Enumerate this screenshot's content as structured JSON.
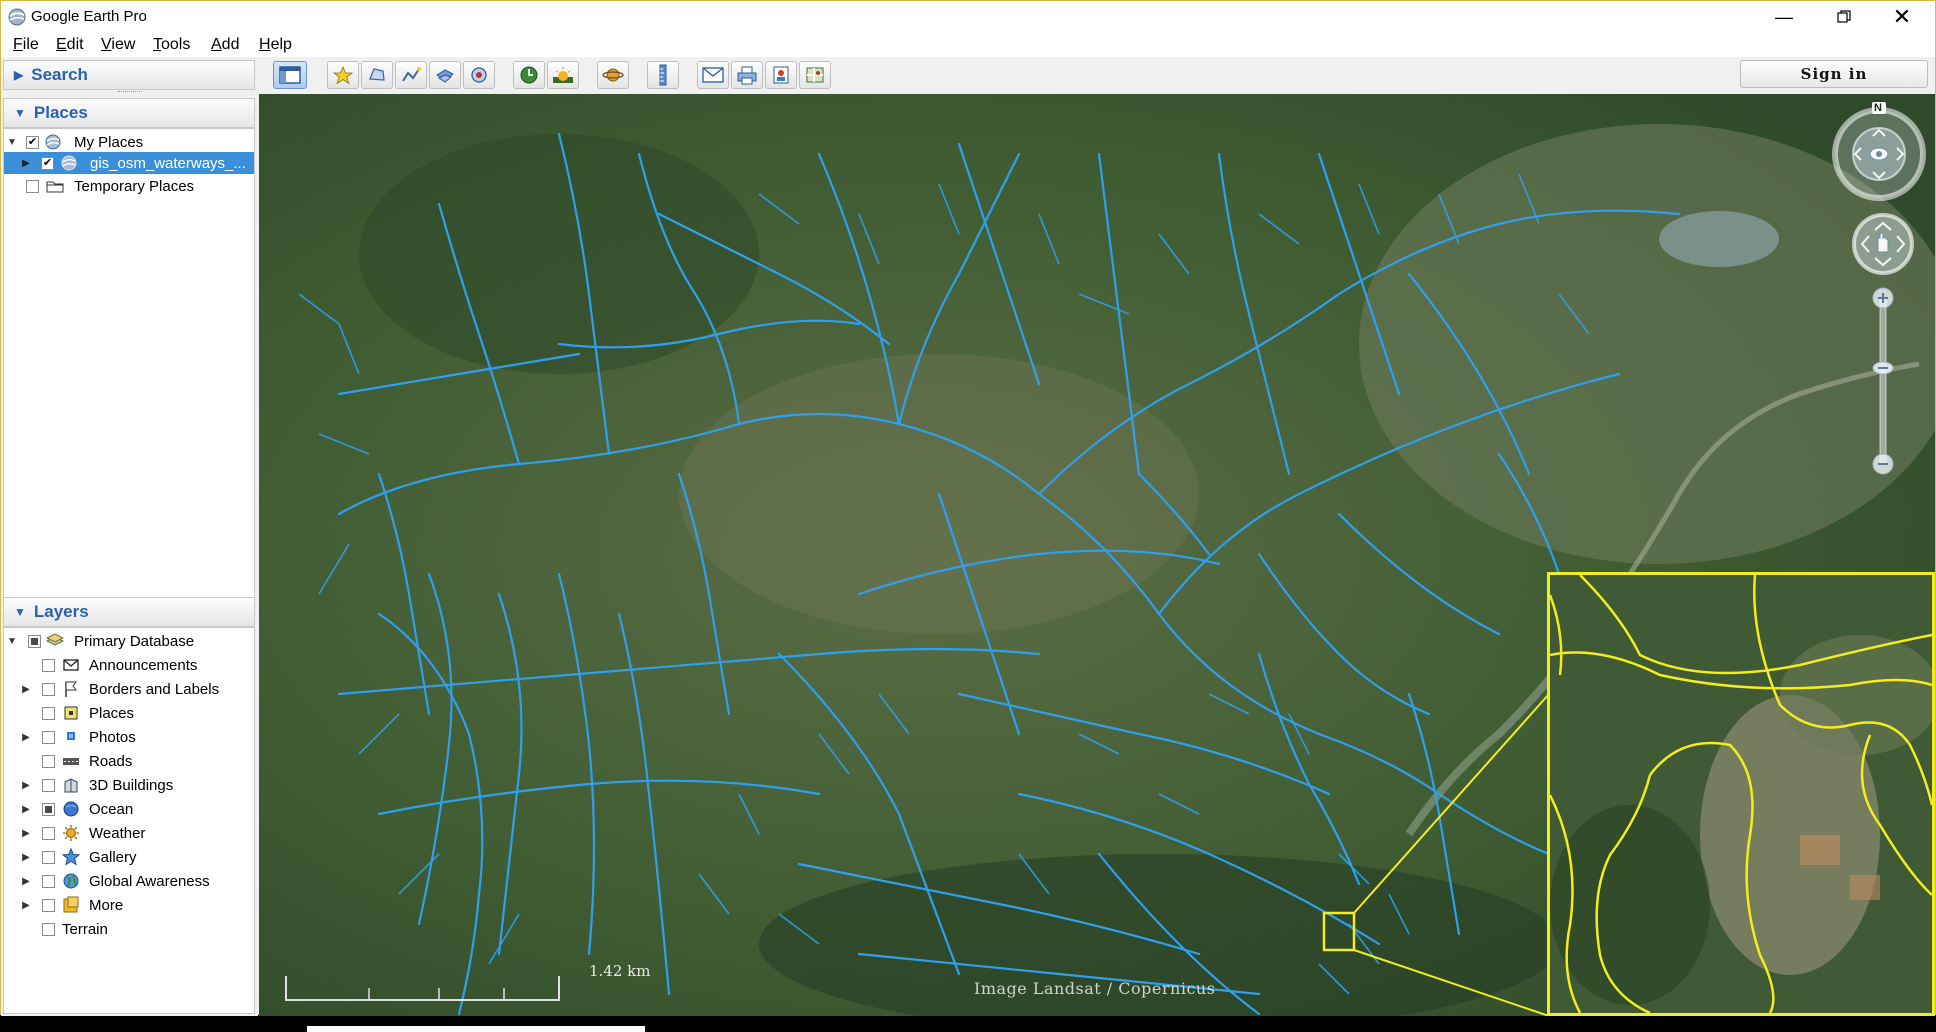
{
  "window": {
    "title": "Google Earth Pro",
    "controls": [
      "minimize",
      "maximize",
      "close"
    ]
  },
  "menu": [
    {
      "label": "File",
      "key": "F",
      "rest": "ile"
    },
    {
      "label": "Edit",
      "key": "E",
      "rest": "dit"
    },
    {
      "label": "View",
      "key": "V",
      "rest": "iew"
    },
    {
      "label": "Tools",
      "key": "T",
      "rest": "ools"
    },
    {
      "label": "Add",
      "key": "A",
      "rest": "dd"
    },
    {
      "label": "Help",
      "key": "H",
      "rest": "elp"
    }
  ],
  "toolbar": {
    "buttons": [
      "sidebar-toggle-icon",
      "placemark-icon",
      "polygon-icon",
      "path-icon",
      "image-overlay-icon",
      "record-tour-icon",
      "historical-imagery-icon",
      "sunlight-icon",
      "planets-icon",
      "ruler-icon",
      "email-icon",
      "print-icon",
      "save-image-icon",
      "view-in-maps-icon"
    ],
    "sign_in": "Sign in"
  },
  "search": {
    "header": "Search"
  },
  "places": {
    "header": "Places",
    "items": [
      {
        "label": "My Places",
        "checked": true
      },
      {
        "label": "gis_osm_waterways_...",
        "checked": true,
        "selected": true
      },
      {
        "label": "Temporary Places",
        "checked": false
      }
    ]
  },
  "layers": {
    "header": "Layers",
    "items": [
      {
        "label": "Primary Database",
        "state": "partial"
      },
      {
        "label": "Announcements",
        "state": "unchecked"
      },
      {
        "label": "Borders and Labels",
        "state": "unchecked"
      },
      {
        "label": "Places",
        "state": "unchecked"
      },
      {
        "label": "Photos",
        "state": "unchecked"
      },
      {
        "label": "Roads",
        "state": "unchecked"
      },
      {
        "label": "3D Buildings",
        "state": "unchecked"
      },
      {
        "label": "Ocean",
        "state": "partial"
      },
      {
        "label": "Weather",
        "state": "unchecked"
      },
      {
        "label": "Gallery",
        "state": "unchecked"
      },
      {
        "label": "Global Awareness",
        "state": "unchecked"
      },
      {
        "label": "More",
        "state": "unchecked"
      },
      {
        "label": "Terrain",
        "state": "unchecked"
      }
    ]
  },
  "map": {
    "credit": "Image Landsat / Copernicus",
    "scale_label": "1.42 km",
    "compass_label": "N",
    "river_color": "#2ea0ee",
    "highlight_color": "#f2ee1e"
  }
}
